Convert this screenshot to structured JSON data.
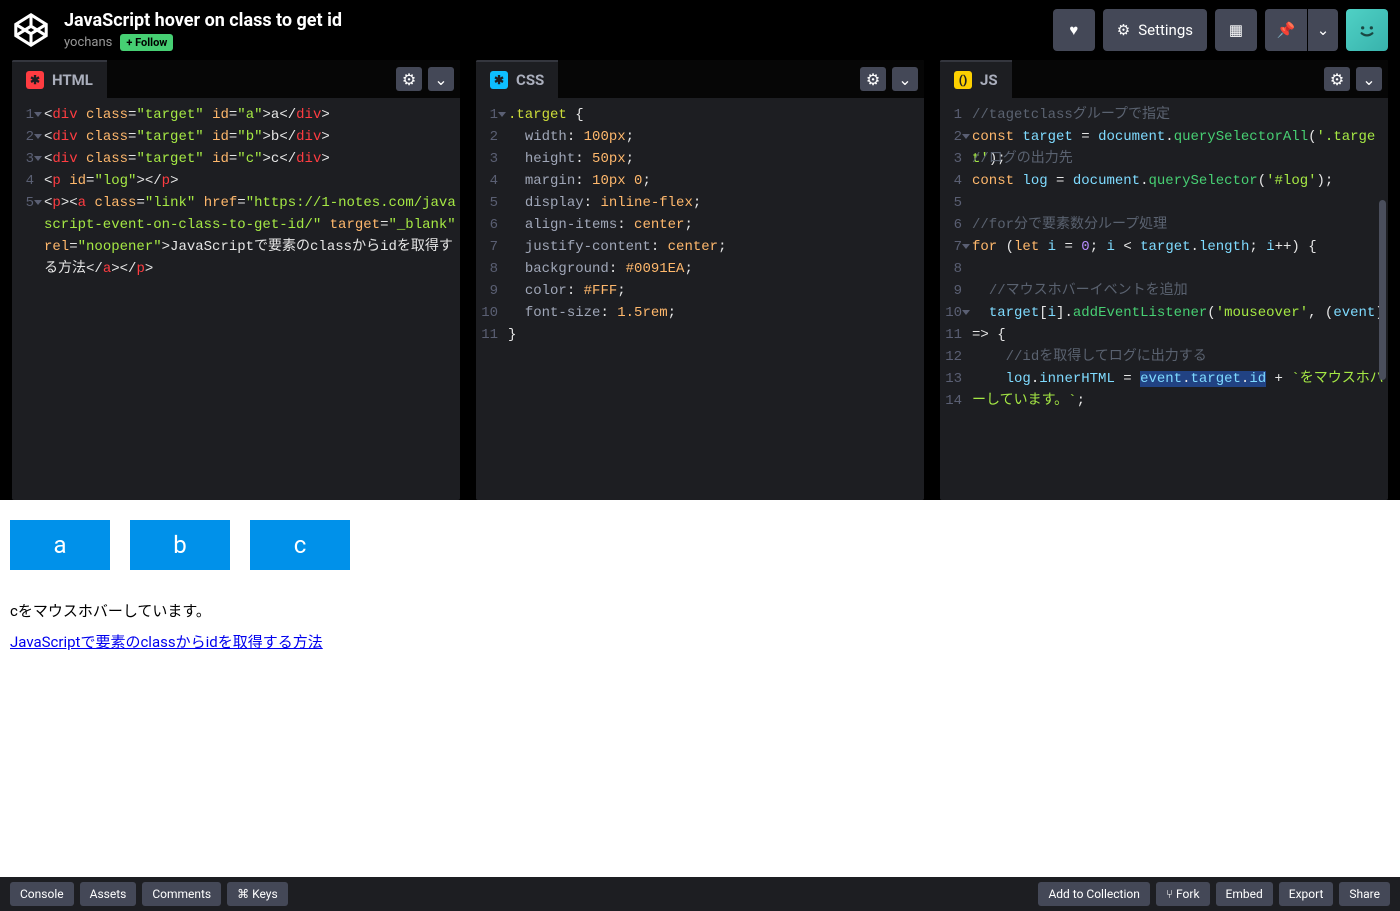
{
  "header": {
    "title": "JavaScript hover on class to get id",
    "author": "yochans",
    "follow": "+ Follow",
    "settings": "Settings"
  },
  "panels": {
    "html": {
      "label": "HTML"
    },
    "css": {
      "label": "CSS"
    },
    "js": {
      "label": "JS"
    }
  },
  "code": {
    "html_lines": [
      {
        "n": "1",
        "html": "<span class='tok-punc'>&lt;</span><span class='tok-tag'>div</span> <span class='tok-attr'>class</span><span class='tok-punc'>=</span><span class='tok-str'>\"target\"</span> <span class='tok-attr'>id</span><span class='tok-punc'>=</span><span class='tok-str'>\"a\"</span><span class='tok-punc'>&gt;</span><span class='tok-text'>a</span><span class='tok-punc'>&lt;/</span><span class='tok-tag'>div</span><span class='tok-punc'>&gt;</span>"
      },
      {
        "n": "2",
        "html": "<span class='tok-punc'>&lt;</span><span class='tok-tag'>div</span> <span class='tok-attr'>class</span><span class='tok-punc'>=</span><span class='tok-str'>\"target\"</span> <span class='tok-attr'>id</span><span class='tok-punc'>=</span><span class='tok-str'>\"b\"</span><span class='tok-punc'>&gt;</span><span class='tok-text'>b</span><span class='tok-punc'>&lt;/</span><span class='tok-tag'>div</span><span class='tok-punc'>&gt;</span>"
      },
      {
        "n": "3",
        "html": "<span class='tok-punc'>&lt;</span><span class='tok-tag'>div</span> <span class='tok-attr'>class</span><span class='tok-punc'>=</span><span class='tok-str'>\"target\"</span> <span class='tok-attr'>id</span><span class='tok-punc'>=</span><span class='tok-str'>\"c\"</span><span class='tok-punc'>&gt;</span><span class='tok-text'>c</span><span class='tok-punc'>&lt;/</span><span class='tok-tag'>div</span><span class='tok-punc'>&gt;</span>"
      },
      {
        "n": "4",
        "html": "<span class='tok-punc'>&lt;</span><span class='tok-tag'>p</span> <span class='tok-attr'>id</span><span class='tok-punc'>=</span><span class='tok-str'>\"log\"</span><span class='tok-punc'>&gt;&lt;/</span><span class='tok-tag'>p</span><span class='tok-punc'>&gt;</span>"
      },
      {
        "n": "5",
        "html": "<span class='tok-punc'>&lt;</span><span class='tok-tag'>p</span><span class='tok-punc'>&gt;&lt;</span><span class='tok-tag'>a</span> <span class='tok-attr'>class</span><span class='tok-punc'>=</span><span class='tok-str'>\"link\"</span> <span class='tok-attr'>href</span><span class='tok-punc'>=</span><span class='tok-str'>\"https://1-notes.com/javascript-event-on-class-to-get-id/\"</span> <span class='tok-attr'>target</span><span class='tok-punc'>=</span><span class='tok-str'>\"_blank\"</span> <span class='tok-attr'>rel</span><span class='tok-punc'>=</span><span class='tok-str'>\"noopener\"</span><span class='tok-punc'>&gt;</span><span class='tok-text'>JavaScriptで要素のclassからidを取得する方法</span><span class='tok-punc'>&lt;/</span><span class='tok-tag'>a</span><span class='tok-punc'>&gt;&lt;/</span><span class='tok-tag'>p</span><span class='tok-punc'>&gt;</span>"
      }
    ],
    "css_lines": [
      {
        "n": "1",
        "html": "<span class='tok-sel'>.target</span> <span class='tok-punc'>{</span>"
      },
      {
        "n": "2",
        "html": "  <span class='tok-prop'>width</span><span class='tok-punc'>:</span> <span class='tok-kw'>100px</span><span class='tok-punc'>;</span>"
      },
      {
        "n": "3",
        "html": "  <span class='tok-prop'>height</span><span class='tok-punc'>:</span> <span class='tok-kw'>50px</span><span class='tok-punc'>;</span>"
      },
      {
        "n": "4",
        "html": "  <span class='tok-prop'>margin</span><span class='tok-punc'>:</span> <span class='tok-kw'>10px 0</span><span class='tok-punc'>;</span>"
      },
      {
        "n": "5",
        "html": "  <span class='tok-prop'>display</span><span class='tok-punc'>:</span> <span class='tok-kw'>inline-flex</span><span class='tok-punc'>;</span>"
      },
      {
        "n": "6",
        "html": "  <span class='tok-prop'>align-items</span><span class='tok-punc'>:</span> <span class='tok-kw'>center</span><span class='tok-punc'>;</span>"
      },
      {
        "n": "7",
        "html": "  <span class='tok-prop'>justify-content</span><span class='tok-punc'>:</span> <span class='tok-kw'>center</span><span class='tok-punc'>;</span>"
      },
      {
        "n": "8",
        "html": "  <span class='tok-prop'>background</span><span class='tok-punc'>:</span> <span class='tok-kw'>#0091EA</span><span class='tok-punc'>;</span>"
      },
      {
        "n": "9",
        "html": "  <span class='tok-prop'>color</span><span class='tok-punc'>:</span> <span class='tok-kw'>#FFF</span><span class='tok-punc'>;</span>"
      },
      {
        "n": "10",
        "html": "  <span class='tok-prop'>font-size</span><span class='tok-punc'>:</span> <span class='tok-kw'>1.5rem</span><span class='tok-punc'>;</span>"
      },
      {
        "n": "11",
        "html": "<span class='tok-punc'>}</span>"
      }
    ],
    "js_lines": [
      {
        "n": "1",
        "html": "<span class='tok-comm'>//tagetclassグループで指定</span>"
      },
      {
        "n": "2",
        "html": "<span class='tok-kw'>const</span> <span class='tok-var'>target</span> <span class='tok-punc'>=</span> <span class='tok-var'>document</span><span class='tok-punc'>.</span><span class='tok-fn'>querySelectorAll</span><span class='tok-punc'>(</span><span class='tok-str'>'.target'</span><span class='tok-punc'>);</span>"
      },
      {
        "n": "3",
        "html": "<span class='tok-comm'>//ログの出力先</span>"
      },
      {
        "n": "4",
        "html": "<span class='tok-kw'>const</span> <span class='tok-var'>log</span> <span class='tok-punc'>=</span> <span class='tok-var'>document</span><span class='tok-punc'>.</span><span class='tok-fn'>querySelector</span><span class='tok-punc'>(</span><span class='tok-str'>'#log'</span><span class='tok-punc'>);</span>"
      },
      {
        "n": "5",
        "html": ""
      },
      {
        "n": "6",
        "html": "<span class='tok-comm'>//for分で要素数分ループ処理</span>"
      },
      {
        "n": "7",
        "html": "<span class='tok-kw'>for</span> <span class='tok-punc'>(</span><span class='tok-kw'>let</span> <span class='tok-var'>i</span> <span class='tok-punc'>=</span> <span class='tok-num'>0</span><span class='tok-punc'>;</span> <span class='tok-var'>i</span> <span class='tok-punc'>&lt;</span> <span class='tok-var'>target</span><span class='tok-punc'>.</span><span class='tok-var'>length</span><span class='tok-punc'>;</span> <span class='tok-var'>i</span><span class='tok-punc'>++) {</span>"
      },
      {
        "n": "8",
        "html": ""
      },
      {
        "n": "9",
        "html": "  <span class='tok-comm'>//マウスホバーイベントを追加</span>"
      },
      {
        "n": "10",
        "html": "  <span class='tok-var'>target</span><span class='tok-punc'>[</span><span class='tok-var'>i</span><span class='tok-punc'>].</span><span class='tok-fn'>addEventListener</span><span class='tok-punc'>(</span><span class='tok-str'>'mouseover'</span><span class='tok-punc'>,</span> <span class='tok-punc'>(</span><span class='tok-var'>event</span><span class='tok-punc'>) =&gt; {</span>"
      },
      {
        "n": "11",
        "html": ""
      },
      {
        "n": "12",
        "html": "    <span class='tok-comm'>//idを取得してログに出力する</span>"
      },
      {
        "n": "13",
        "html": "    <span class='tok-var'>log</span><span class='tok-punc'>.</span><span class='tok-var'>innerHTML</span> <span class='tok-punc'>=</span> <span class='hl'><span class='tok-var'>event</span><span class='tok-punc'>.</span><span class='tok-var'>target</span><span class='tok-punc'>.</span><span class='tok-var'>id</span></span> <span class='tok-punc'>+</span> <span class='tok-str'>`をマウスホバーしています。`</span><span class='tok-punc'>;</span>"
      },
      {
        "n": "14",
        "html": ""
      }
    ]
  },
  "preview": {
    "targets": [
      "a",
      "b",
      "c"
    ],
    "log": "cをマウスホバーしています。",
    "link": "JavaScriptで要素のclassからidを取得する方法"
  },
  "footer": {
    "console": "Console",
    "assets": "Assets",
    "comments": "Comments",
    "keys": "⌘ Keys",
    "add_collection": "Add to Collection",
    "fork": "⑂ Fork",
    "embed": "Embed",
    "export": "Export",
    "share": "Share"
  }
}
